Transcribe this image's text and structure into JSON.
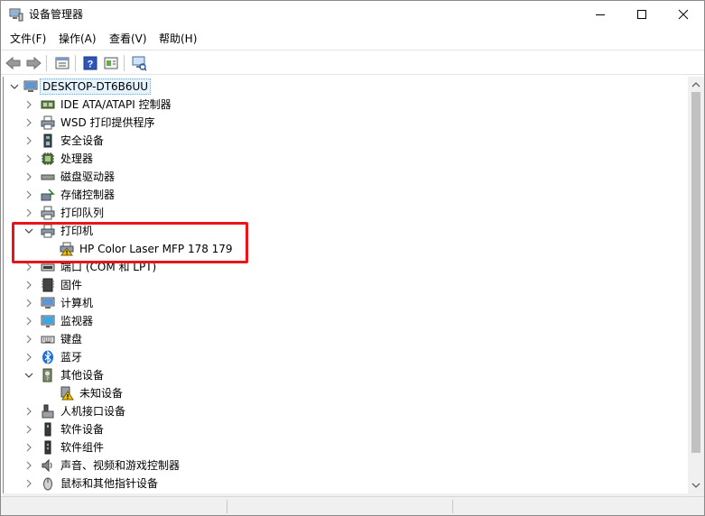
{
  "window": {
    "title": "设备管理器"
  },
  "menu": [
    "文件(F)",
    "操作(A)",
    "查看(V)",
    "帮助(H)"
  ],
  "toolbar": {
    "buttons": [
      "back-arrow-icon",
      "forward-arrow-icon",
      "properties-icon",
      "help-icon",
      "update-driver-icon",
      "scan-hardware-icon"
    ]
  },
  "tree": {
    "root": "DESKTOP-DT6B6UU",
    "items": [
      {
        "label": "IDE ATA/ATAPI 控制器",
        "icon": "ide-controller-icon",
        "expanded": false
      },
      {
        "label": "WSD 打印提供程序",
        "icon": "printer-icon",
        "expanded": false
      },
      {
        "label": "安全设备",
        "icon": "security-device-icon",
        "expanded": false
      },
      {
        "label": "处理器",
        "icon": "processor-icon",
        "expanded": false
      },
      {
        "label": "磁盘驱动器",
        "icon": "disk-drive-icon",
        "expanded": false
      },
      {
        "label": "存储控制器",
        "icon": "storage-controller-icon",
        "expanded": false
      },
      {
        "label": "打印队列",
        "icon": "print-queue-icon",
        "expanded": false
      },
      {
        "label": "打印机",
        "icon": "printer-icon",
        "expanded": true,
        "children": [
          {
            "label": "HP Color Laser MFP 178 179",
            "icon": "printer-warning-icon"
          }
        ]
      },
      {
        "label": "端口 (COM 和 LPT)",
        "icon": "port-icon",
        "expanded": false
      },
      {
        "label": "固件",
        "icon": "firmware-icon",
        "expanded": false
      },
      {
        "label": "计算机",
        "icon": "computer-icon",
        "expanded": false
      },
      {
        "label": "监视器",
        "icon": "monitor-icon",
        "expanded": false
      },
      {
        "label": "键盘",
        "icon": "keyboard-icon",
        "expanded": false
      },
      {
        "label": "蓝牙",
        "icon": "bluetooth-icon",
        "expanded": false
      },
      {
        "label": "其他设备",
        "icon": "other-devices-icon",
        "expanded": true,
        "children": [
          {
            "label": "未知设备",
            "icon": "unknown-device-warning-icon"
          }
        ]
      },
      {
        "label": "人机接口设备",
        "icon": "hid-icon",
        "expanded": false
      },
      {
        "label": "软件设备",
        "icon": "software-device-icon",
        "expanded": false
      },
      {
        "label": "软件组件",
        "icon": "software-component-icon",
        "expanded": false
      },
      {
        "label": "声音、视频和游戏控制器",
        "icon": "sound-icon",
        "expanded": false
      },
      {
        "label": "鼠标和其他指针设备",
        "icon": "mouse-icon",
        "expanded": false
      }
    ]
  },
  "colors": {
    "highlight": "#e8151b",
    "selection": "#e5f3ff",
    "scrollbar": "#c1c1c1"
  }
}
